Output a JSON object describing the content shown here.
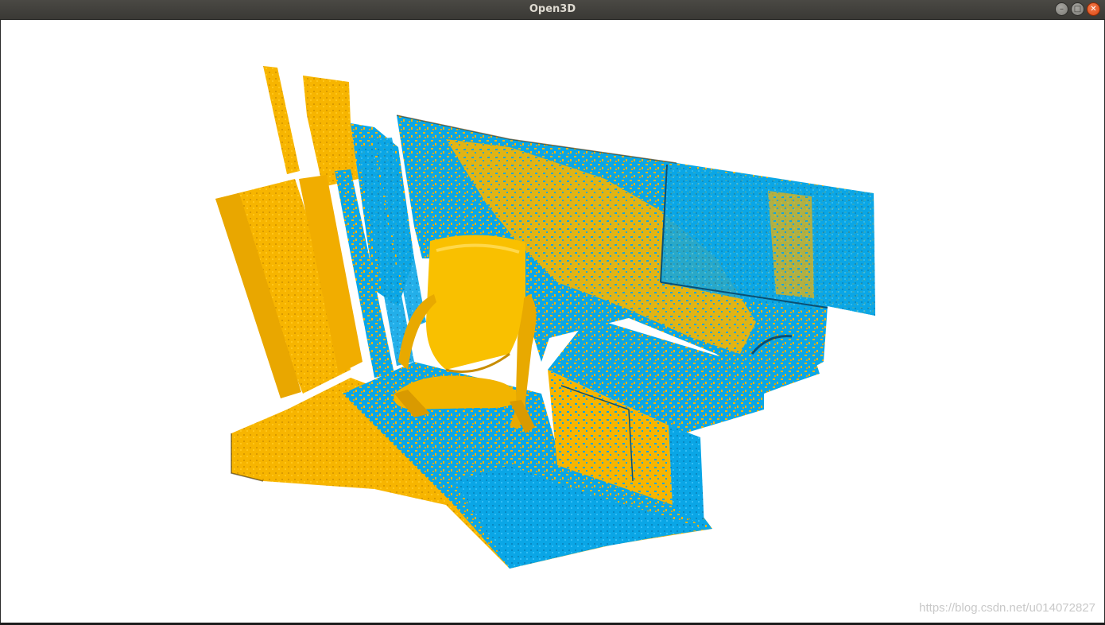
{
  "window": {
    "title": "Open3D",
    "buttons": {
      "minimize": "–",
      "maximize": "□",
      "close": "✕"
    }
  },
  "scene": {
    "description_colors": {
      "source_cloud": "#f7b500",
      "target_cloud": "#009fe3",
      "background": "#ffffff"
    },
    "icons": [
      "minimize-icon",
      "maximize-icon",
      "close-icon"
    ]
  },
  "watermark": "https://blog.csdn.net/u014072827"
}
